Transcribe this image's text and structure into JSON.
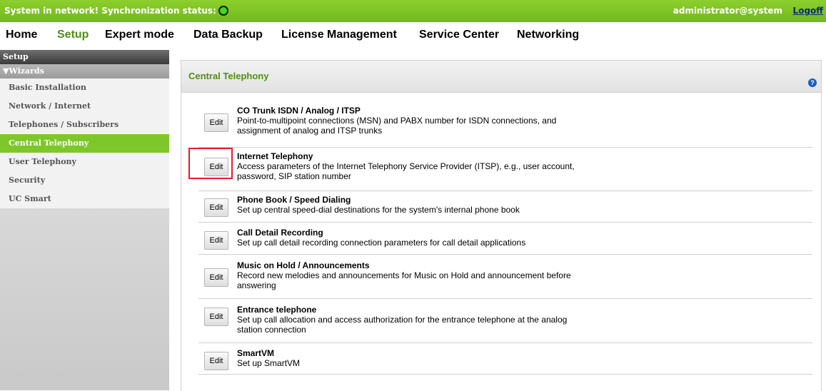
{
  "topbar": {
    "status_text": "System in network!  Synchronization status:",
    "user": "administrator@system",
    "logoff": "Logoff",
    "sync_color": "#3ddb1a"
  },
  "menu": {
    "items": [
      "Home",
      "Setup",
      "Expert mode",
      "Data Backup",
      "License Management",
      "Service Center",
      "Networking"
    ],
    "active": "Setup"
  },
  "sidebar": {
    "header": "Setup",
    "group": "Wizards",
    "items": [
      {
        "label": "Basic Installation"
      },
      {
        "label": "Network / Internet"
      },
      {
        "label": "Telephones / Subscribers"
      },
      {
        "label": "Central Telephony",
        "active": true
      },
      {
        "label": "User Telephony"
      },
      {
        "label": "Security"
      },
      {
        "label": "UC Smart"
      }
    ]
  },
  "panel": {
    "title": "Central Telephony",
    "help_icon": "?",
    "edit_label": "Edit",
    "rows": [
      {
        "title": "CO Trunk ISDN / Analog / ITSP",
        "line1": "Point-to-multipoint connections (MSN) and PABX number for ISDN connections, and",
        "line2": "assignment of analog and ITSP trunks"
      },
      {
        "title": "Internet Telephony",
        "line1": "Access parameters of the Internet Telephony Service Provider (ITSP), e.g., user account,",
        "line2": "password, SIP station number"
      },
      {
        "title": "Phone Book / Speed Dialing",
        "line1": "Set up central speed-dial destinations for the system's internal phone book",
        "line2": ""
      },
      {
        "title": "Call Detail Recording",
        "line1": "Set up call detail recording connection parameters for call detail applications",
        "line2": ""
      },
      {
        "title": "Music on Hold / Announcements",
        "line1": "Record new melodies and announcements for Music on Hold and announcement before",
        "line2": "answering"
      },
      {
        "title": "Entrance telephone",
        "line1": "Set up call allocation and access authorization for the entrance telephone at the analog",
        "line2": "station connection"
      },
      {
        "title": "SmartVM",
        "line1": "Set up SmartVM",
        "line2": ""
      }
    ]
  }
}
